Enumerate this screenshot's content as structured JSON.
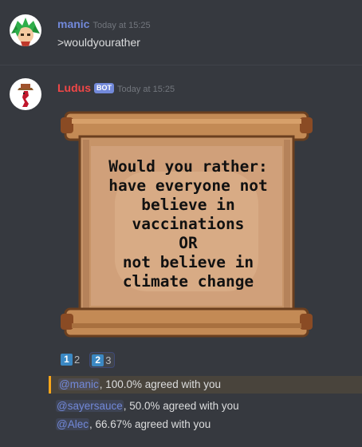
{
  "messages": [
    {
      "author": "manic",
      "author_color": "#7289da",
      "timestamp": "Today at 15:25",
      "text": ">wouldyourather"
    },
    {
      "author": "Ludus",
      "author_color": "#f04747",
      "bot_tag": "BOT",
      "timestamp": "Today at 15:25",
      "scroll_lines": [
        "Would you rather:",
        "have everyone not",
        "believe in",
        "vaccinations",
        "OR",
        "not believe in",
        "climate change"
      ]
    }
  ],
  "reactions": [
    {
      "emoji": "1",
      "count": "2"
    },
    {
      "emoji": "2",
      "count": "3"
    }
  ],
  "results": [
    {
      "mention": "@manic",
      "text": ", 100.0% agreed with you",
      "highlighted": true
    },
    {
      "mention": "@sayersauce",
      "text": ", 50.0% agreed with you",
      "highlighted": false
    },
    {
      "mention": "@Alec",
      "text": ", 66.67% agreed with you",
      "highlighted": false
    }
  ]
}
